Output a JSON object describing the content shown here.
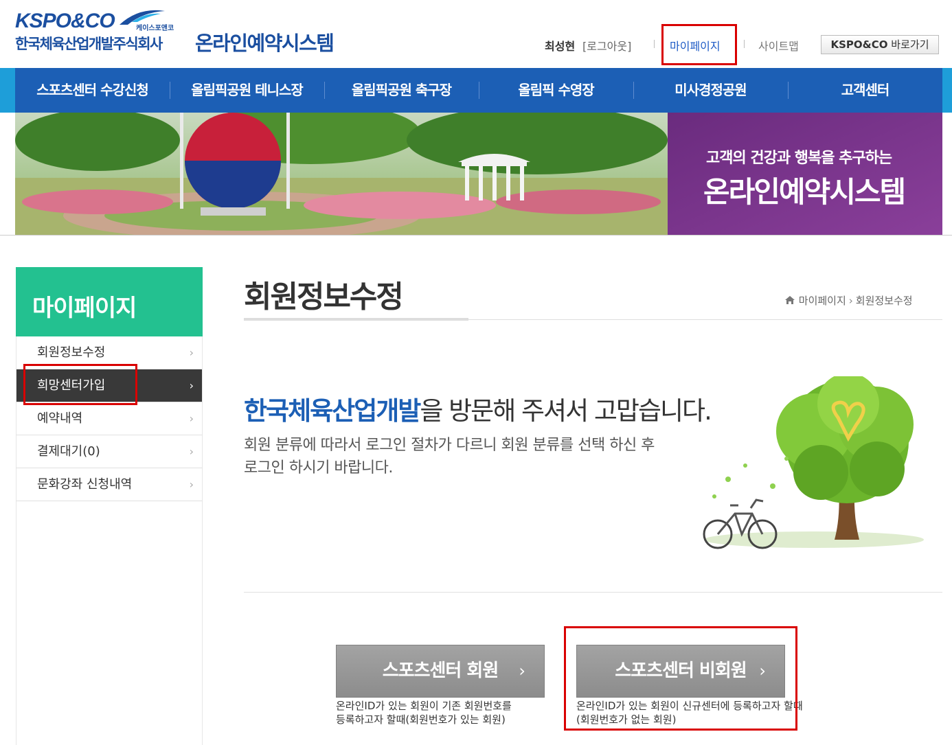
{
  "header": {
    "logo_brand": "KSPO&CO",
    "logo_sub": "케이스포앤코",
    "logo_company": "한국체육산업개발주식회사",
    "logo_system": "온라인예약시스템",
    "user_name": "최성현",
    "logout": "[로그아웃]",
    "mypage": "마이페이지",
    "sitemap": "사이트맵",
    "kspo_brand": "KSPO&CO",
    "kspo_link": "바로가기"
  },
  "nav": {
    "items": [
      {
        "label": "스포츠센터 수강신청"
      },
      {
        "label": "올림픽공원 테니스장"
      },
      {
        "label": "올림픽공원 축구장"
      },
      {
        "label": "올림픽 수영장"
      },
      {
        "label": "미사경정공원"
      },
      {
        "label": "고객센터"
      }
    ]
  },
  "banner": {
    "line1": "고객의 건강과 행복을 추구하는",
    "line2": "온라인예약시스템"
  },
  "sidebar": {
    "title": "마이페이지",
    "items": [
      {
        "label": "회원정보수정"
      },
      {
        "label": "희망센터가입"
      },
      {
        "label": "예약내역"
      },
      {
        "label": "결제대기(0)"
      },
      {
        "label": "문화강좌 신청내역"
      }
    ]
  },
  "content": {
    "page_title": "회원정보수정",
    "breadcrumb": [
      "마이페이지",
      "회원정보수정"
    ],
    "welcome_highlight": "한국체육산업개발",
    "welcome_rest": "을 방문해 주셔서 고맙습니다.",
    "desc_line1": "회원 분류에 따라서 로그인 절차가 다르니 회원 분류를 선택 하신 후",
    "desc_line2": "로그인 하시기 바랍니다.",
    "buttons": [
      {
        "label": "스포츠센터 회원",
        "desc1": "온라인ID가 있는 회원이 기존 회원번호를",
        "desc2": "등록하고자 할때(회원번호가 있는 회원)"
      },
      {
        "label": "스포츠센터 비회원",
        "desc1": "온라인ID가 있는 회원이 신규센터에 등록하고자 할때",
        "desc2": "(회원번호가 없는 회원)"
      }
    ]
  },
  "colors": {
    "brand_blue": "#1c5fb5",
    "sidebar_green": "#23c190",
    "highlight_red": "#d90000"
  }
}
